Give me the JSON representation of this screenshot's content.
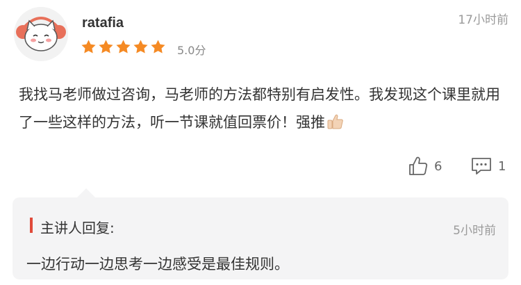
{
  "review": {
    "username": "ratafia",
    "rating": 5,
    "score_text": "5.0分",
    "time": "17小时前",
    "text": "我找马老师做过咨询，马老师的方法都特别有启发性。我发现这个课里就用了一些这样的方法，听一节课就值回票价！强推",
    "text_emoji": "thumbs-up-emoji",
    "likes": "6",
    "comments": "1"
  },
  "reply": {
    "title": "主讲人回复:",
    "time": "5小时前",
    "text": "一边行动一边思考一边感受是最佳规则。"
  },
  "colors": {
    "star": "#f58a24",
    "reply_bar": "#e04a3a",
    "reply_bg": "#f4f4f5"
  }
}
